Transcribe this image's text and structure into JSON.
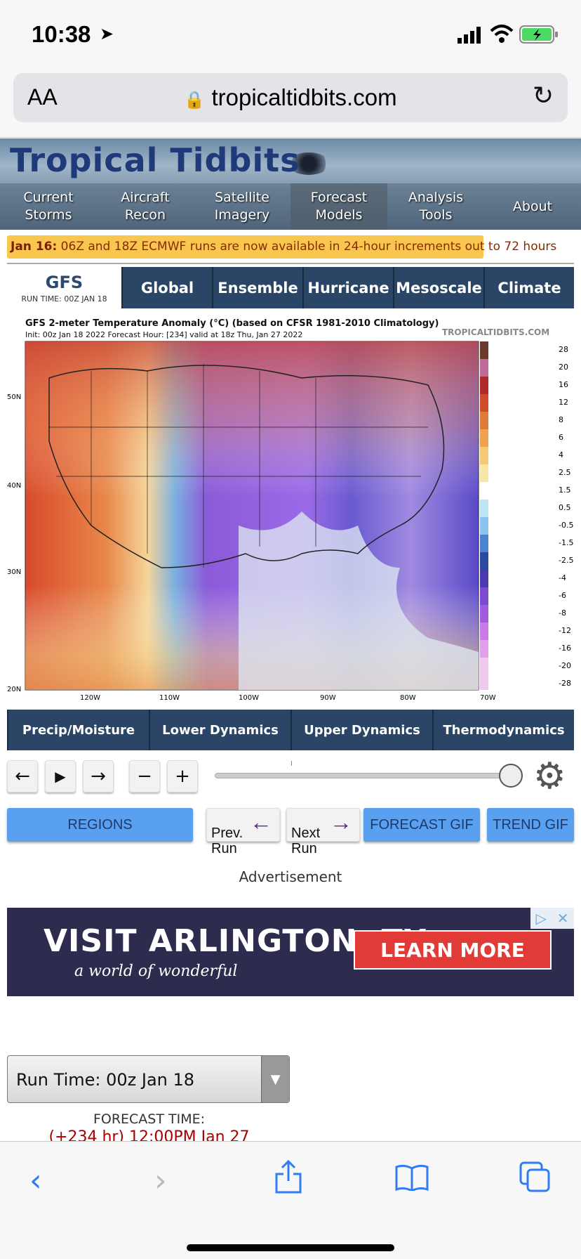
{
  "status": {
    "time": "10:38"
  },
  "browser": {
    "text_size": "AA",
    "url": "tropicaltidbits.com"
  },
  "site": {
    "logo": "Tropical Tidbits",
    "nav": [
      {
        "label": "Current\nStorms"
      },
      {
        "label": "Aircraft\nRecon"
      },
      {
        "label": "Satellite\nImagery"
      },
      {
        "label": "Forecast\nModels"
      },
      {
        "label": "Analysis\nTools"
      },
      {
        "label": "About"
      }
    ],
    "notice_date": "Jan 16:",
    "notice_text": " 06Z and 18Z ECMWF runs are now available in 24-hour increments out to 72 hours"
  },
  "model": {
    "name": "GFS",
    "run_time": "RUN TIME: 00Z JAN 18",
    "tabs": [
      "Global",
      "Ensemble",
      "Hurricane",
      "Mesoscale",
      "Climate"
    ]
  },
  "map": {
    "title": "GFS 2-meter Temperature Anomaly (°C) (based on CFSR 1981-2010 Climatology)",
    "subtitle": "Init: 00z Jan 18 2022   Forecast Hour: [234]   valid at 18z Thu, Jan 27 2022",
    "brand": "TROPICALTIDBITS.COM",
    "lat_labels": [
      "50N",
      "40N",
      "30N",
      "20N"
    ],
    "lon_labels": [
      "120W",
      "110W",
      "100W",
      "90W",
      "80W",
      "70W"
    ],
    "scale_labels": [
      "28",
      "20",
      "16",
      "12",
      "8",
      "6",
      "4",
      "2.5",
      "1.5",
      "0.5",
      "-0.5",
      "-1.5",
      "-2.5",
      "-4",
      "-6",
      "-8",
      "-12",
      "-16",
      "-20",
      "-28"
    ]
  },
  "categories": [
    "Precip/Moisture",
    "Lower Dynamics",
    "Upper Dynamics",
    "Thermodynamics"
  ],
  "controls": {
    "prev": "←",
    "play": "▶",
    "next": "→",
    "minus": "−",
    "plus": "+",
    "slider_value": 1.0
  },
  "buttons": {
    "regions": "REGIONS",
    "prev_run": "Prev.\nRun",
    "next_run": "Next\nRun",
    "forecast_gif": "FORECAST GIF",
    "trend_gif": "TREND GIF"
  },
  "ad": {
    "label": "Advertisement",
    "title": "VISIT ARLINGTON, TX",
    "subtitle": "a world of wonderful",
    "cta": "LEARN MORE"
  },
  "run_select": {
    "value": "Run Time: 00z Jan 18"
  },
  "forecast_time": {
    "label": "FORECAST TIME:",
    "value": "(+234 hr) 12:00PM Jan 27"
  },
  "colors": {
    "nav_bg": "#2b4567",
    "blue_button": "#5aa0f0",
    "notice": "#f9c74f"
  }
}
